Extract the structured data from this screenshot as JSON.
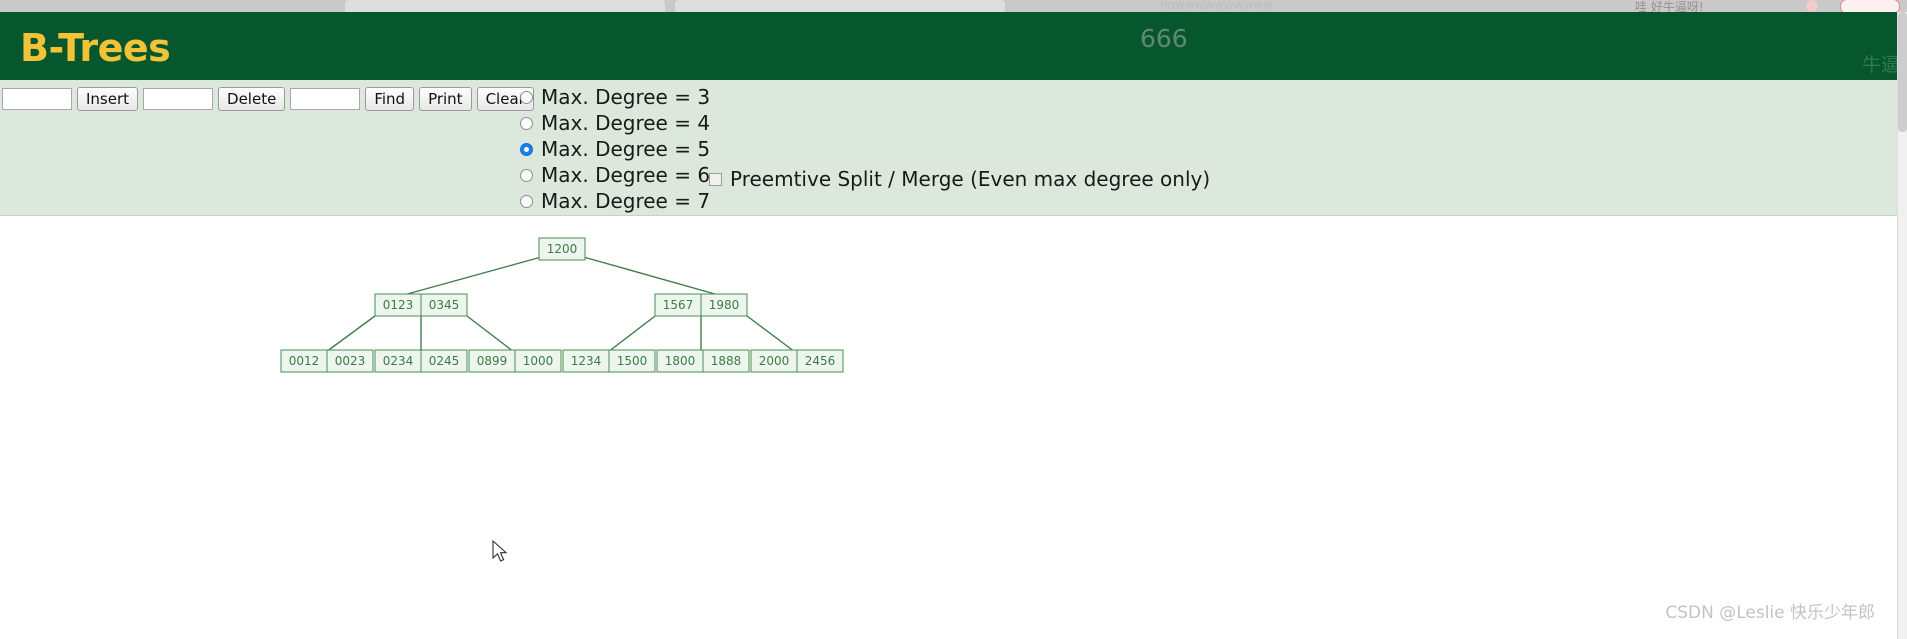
{
  "window": {
    "ghost_tab_text_left": "nowwwwwwwwww",
    "ghost_text_right": "哇 好牛逼呀!",
    "overlay_number": "666",
    "overlay_cn_right": "牛逼"
  },
  "header": {
    "title": "B-Trees",
    "bg_color": "#07572e",
    "title_color": "#f2c337"
  },
  "controls": {
    "insert_value": "",
    "insert_placeholder": "",
    "insert_label": "Insert",
    "delete_value": "",
    "delete_placeholder": "",
    "delete_label": "Delete",
    "find_value": "",
    "find_placeholder": "",
    "find_label": "Find",
    "print_label": "Print",
    "clear_label": "Clear",
    "radios": [
      {
        "label": "Max. Degree = 3",
        "checked": false
      },
      {
        "label": "Max. Degree = 4",
        "checked": false
      },
      {
        "label": "Max. Degree = 5",
        "checked": true
      },
      {
        "label": "Max. Degree = 6",
        "checked": false
      },
      {
        "label": "Max. Degree = 7",
        "checked": false
      }
    ],
    "checkbox": {
      "label": "Preemtive Split / Merge (Even max degree only)",
      "checked": false
    }
  },
  "tree": {
    "accent_color": "#4c8c58",
    "node_fill": "#edf6ed",
    "text_color": "#3d7a4a",
    "root": {
      "keys": [
        "1200"
      ]
    },
    "level2": [
      {
        "keys": [
          "0123",
          "0345"
        ]
      },
      {
        "keys": [
          "1567",
          "1980"
        ]
      }
    ],
    "leaves": [
      {
        "keys": [
          "0012",
          "0023"
        ]
      },
      {
        "keys": [
          "0234",
          "0245"
        ]
      },
      {
        "keys": [
          "0899",
          "1000"
        ]
      },
      {
        "keys": [
          "1234",
          "1500"
        ]
      },
      {
        "keys": [
          "1800",
          "1888"
        ]
      },
      {
        "keys": [
          "2000",
          "2456"
        ]
      }
    ]
  },
  "footer": {
    "watermark": "CSDN @Leslie 快乐少年郎"
  }
}
